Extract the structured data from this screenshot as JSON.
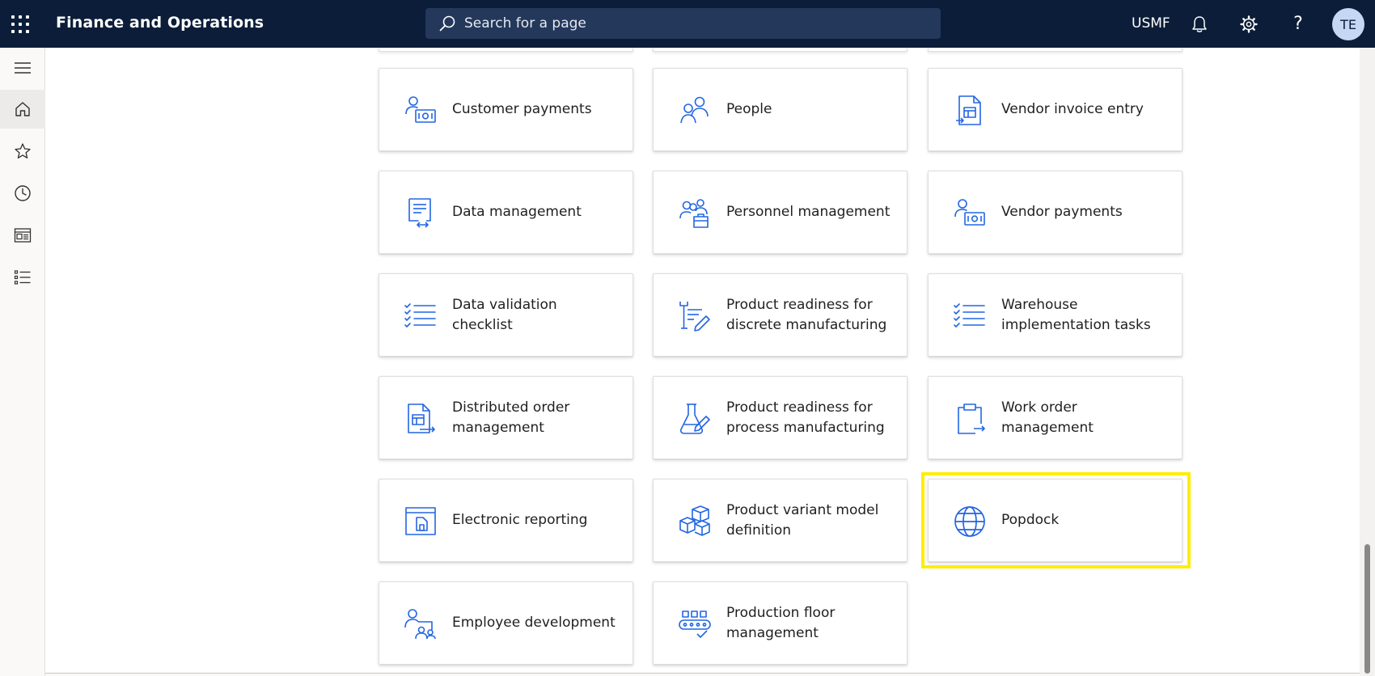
{
  "topbar": {
    "app_title": "Finance and Operations",
    "search_placeholder": "Search for a page",
    "company": "USMF",
    "help_glyph": "?",
    "avatar_initials": "TE",
    "icons": [
      "waffle-icon",
      "search-icon",
      "bell-icon",
      "gear-icon",
      "help-icon"
    ]
  },
  "rail": {
    "items": [
      "hamburger-icon",
      "home-icon",
      "star-icon",
      "clock-icon",
      "workspace-icon",
      "list-icon"
    ],
    "active": "home-icon"
  },
  "tiles": [
    {
      "label": "Customer payments",
      "icon": "customer-payments-icon"
    },
    {
      "label": "People",
      "icon": "people-icon"
    },
    {
      "label": "Vendor invoice entry",
      "icon": "invoice-entry-icon"
    },
    {
      "label": "Data management",
      "icon": "data-management-icon"
    },
    {
      "label": "Personnel management",
      "icon": "personnel-management-icon"
    },
    {
      "label": "Vendor payments",
      "icon": "vendor-payments-icon"
    },
    {
      "label": "Data validation checklist",
      "icon": "checklist-icon"
    },
    {
      "label": "Product readiness for discrete manufacturing",
      "icon": "discrete-manufacturing-icon"
    },
    {
      "label": "Warehouse implementation tasks",
      "icon": "checklist-icon"
    },
    {
      "label": "Distributed order management",
      "icon": "distributed-order-icon"
    },
    {
      "label": "Product readiness for process manufacturing",
      "icon": "flask-icon"
    },
    {
      "label": "Work order management",
      "icon": "clipboard-icon"
    },
    {
      "label": "Electronic reporting",
      "icon": "electronic-reporting-icon"
    },
    {
      "label": "Product variant model definition",
      "icon": "boxes-icon"
    },
    {
      "label": "Popdock",
      "icon": "globe-icon"
    },
    {
      "label": "Employee development",
      "icon": "employee-development-icon"
    },
    {
      "label": "Production floor management",
      "icon": "conveyor-icon"
    }
  ],
  "highlighted_tile": "Popdock",
  "colors": {
    "topbar_bg": "#0b1d38",
    "icon_blue": "#2266e3",
    "highlight": "#ffee00"
  }
}
